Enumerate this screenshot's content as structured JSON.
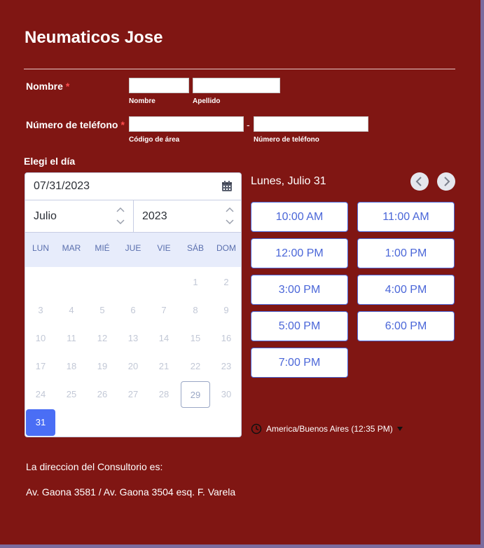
{
  "form": {
    "title": "Neumaticos Jose",
    "name_field": {
      "label": "Nombre",
      "required_mark": "*",
      "first_sublabel": "Nombre",
      "last_sublabel": "Apellido",
      "first_value": "",
      "last_value": ""
    },
    "phone_field": {
      "label": "Número de teléfono",
      "required_mark": "*",
      "area_sublabel": "Código de área",
      "number_sublabel": "Número de teléfono",
      "separator": "-",
      "area_value": "",
      "number_value": ""
    },
    "date_label": "Elegi el día"
  },
  "calendar": {
    "date_value": "07/31/2023",
    "month": "Julio",
    "year": "2023",
    "weekdays": [
      "LUN",
      "MAR",
      "MIÉ",
      "JUE",
      "VIE",
      "SÁB",
      "DOM"
    ],
    "days": [
      [
        "",
        "",
        "",
        "",
        "",
        "1",
        "2"
      ],
      [
        "3",
        "4",
        "5",
        "6",
        "7",
        "8",
        "9"
      ],
      [
        "10",
        "11",
        "12",
        "13",
        "14",
        "15",
        "16"
      ],
      [
        "17",
        "18",
        "19",
        "20",
        "21",
        "22",
        "23"
      ],
      [
        "24",
        "25",
        "26",
        "27",
        "28",
        "29",
        "30"
      ],
      [
        "31",
        "",
        "",
        "",
        "",
        "",
        ""
      ]
    ],
    "today": "29",
    "selected": "31"
  },
  "slots": {
    "day_title": "Lunes, Julio 31",
    "times": [
      "10:00 AM",
      "11:00 AM",
      "12:00 PM",
      "1:00 PM",
      "3:00 PM",
      "4:00 PM",
      "5:00 PM",
      "6:00 PM",
      "7:00 PM"
    ],
    "timezone": "America/Buenos Aires (12:35 PM)"
  },
  "address": {
    "line1": "La direccion del Consultorio es:",
    "line2": "Av. Gaona 3581 / Av. Gaona 3504 esq. F. Varela"
  },
  "colors": {
    "form_bg": "#801613",
    "accent": "#4a66d8",
    "selected_day": "#4a6ef5"
  },
  "icons": [
    "calendar-icon",
    "chevron-left-icon",
    "chevron-right-icon",
    "clock-icon",
    "caret-down-icon",
    "spinner-arrows-icon"
  ]
}
